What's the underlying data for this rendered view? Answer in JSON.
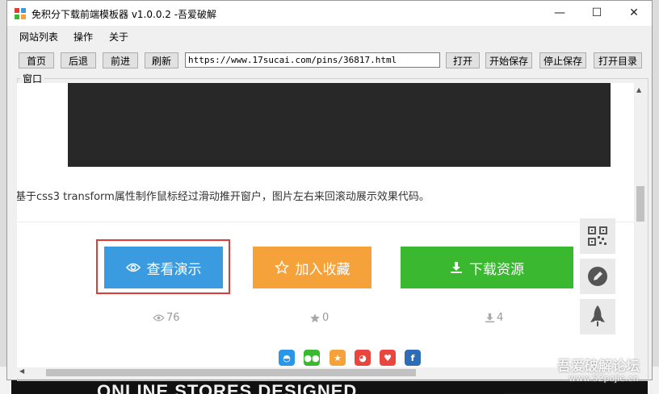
{
  "window": {
    "title": "免积分下载前端模板器  v1.0.0.2 -吾爱破解",
    "minimize": "—",
    "maximize": "☐",
    "close": "✕"
  },
  "menu": [
    "网站列表",
    "操作",
    "关于"
  ],
  "toolbar": {
    "home": "首页",
    "back": "后退",
    "forward": "前进",
    "refresh": "刷新",
    "url": "https://www.17sucai.com/pins/36817.html",
    "open": "打开",
    "start_save": "开始保存",
    "stop_save": "停止保存",
    "open_dir": "打开目录"
  },
  "group_label": "窗口",
  "page": {
    "description": "基于css3 transform属性制作鼠标经过滑动推开窗户，图片左右来回滚动展示效果代码。",
    "demo_button": "查看演示",
    "favorite_button": "加入收藏",
    "download_button": "下载资源",
    "views": "76",
    "favorites": "0",
    "downloads": "4"
  },
  "background": {
    "headline": "ONLINE STORES DESIGNED"
  },
  "watermark": {
    "text": "吾爱破解论坛",
    "url": "www.52pojie.cn"
  },
  "colors": {
    "demo": "#3a9be0",
    "favorite": "#f6a23b",
    "download": "#3ab930",
    "highlight": "#e53935"
  }
}
